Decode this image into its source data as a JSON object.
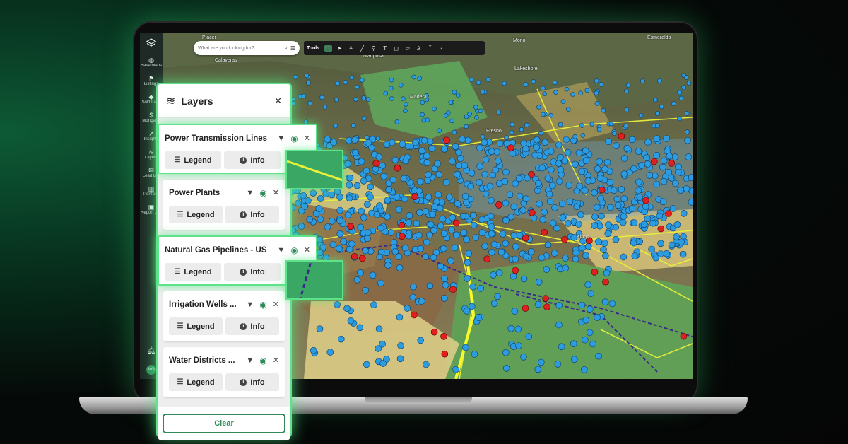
{
  "search": {
    "placeholder": "What are you looking for?"
  },
  "toolbar": {
    "label": "Tools",
    "tools": [
      "lasso-icon",
      "pointer-icon",
      "crop-icon",
      "line-icon",
      "pin-icon",
      "text-icon",
      "shape-icon",
      "ruler-icon",
      "person-icon",
      "upload-icon",
      "collapse-icon"
    ]
  },
  "sidebar": {
    "items": [
      {
        "label": "Base Maps",
        "icon": "globe-icon"
      },
      {
        "label": "Listings",
        "icon": "flag-icon"
      },
      {
        "label": "Sold Land",
        "icon": "tag-icon"
      },
      {
        "label": "Mortgage",
        "icon": "dollar-icon"
      },
      {
        "label": "Insights",
        "icon": "trend-icon"
      },
      {
        "label": "Layers",
        "icon": "layers-icon"
      },
      {
        "label": "Lead List",
        "icon": "mail-icon"
      },
      {
        "label": "Portfolio",
        "icon": "portfolio-icon"
      },
      {
        "label": "Report Center",
        "icon": "briefcase-icon"
      }
    ],
    "avatar": "MG"
  },
  "map_labels": {
    "placer": "Placer",
    "calaveras": "Calaveras",
    "mariposa": "Mariposa",
    "madera": "Madera",
    "fresno": "Fresno",
    "kings": "Kings",
    "mono": "Mono",
    "esmeralda": "Esmeralda",
    "lakeshore": "Lakeshore"
  },
  "layers_panel": {
    "title": "Layers",
    "legend_label": "Legend",
    "info_label": "Info",
    "clear_label": "Clear",
    "layers": [
      {
        "name": "Power Transmission Lines",
        "highlighted": true
      },
      {
        "name": "Power Plants",
        "highlighted": false
      },
      {
        "name": "Natural Gas Pipelines -  US",
        "highlighted": true
      },
      {
        "name": "Irrigation Wells ...",
        "highlighted": false
      },
      {
        "name": "Water Districts ...",
        "highlighted": false
      }
    ]
  },
  "colors": {
    "accent": "#2f8a57",
    "glow": "#5fe38a",
    "well_point": "#2d9be0",
    "plant_point": "#e02020",
    "transmission_line": "#e8f03a",
    "gas_pipeline": "#3a2a8a"
  }
}
